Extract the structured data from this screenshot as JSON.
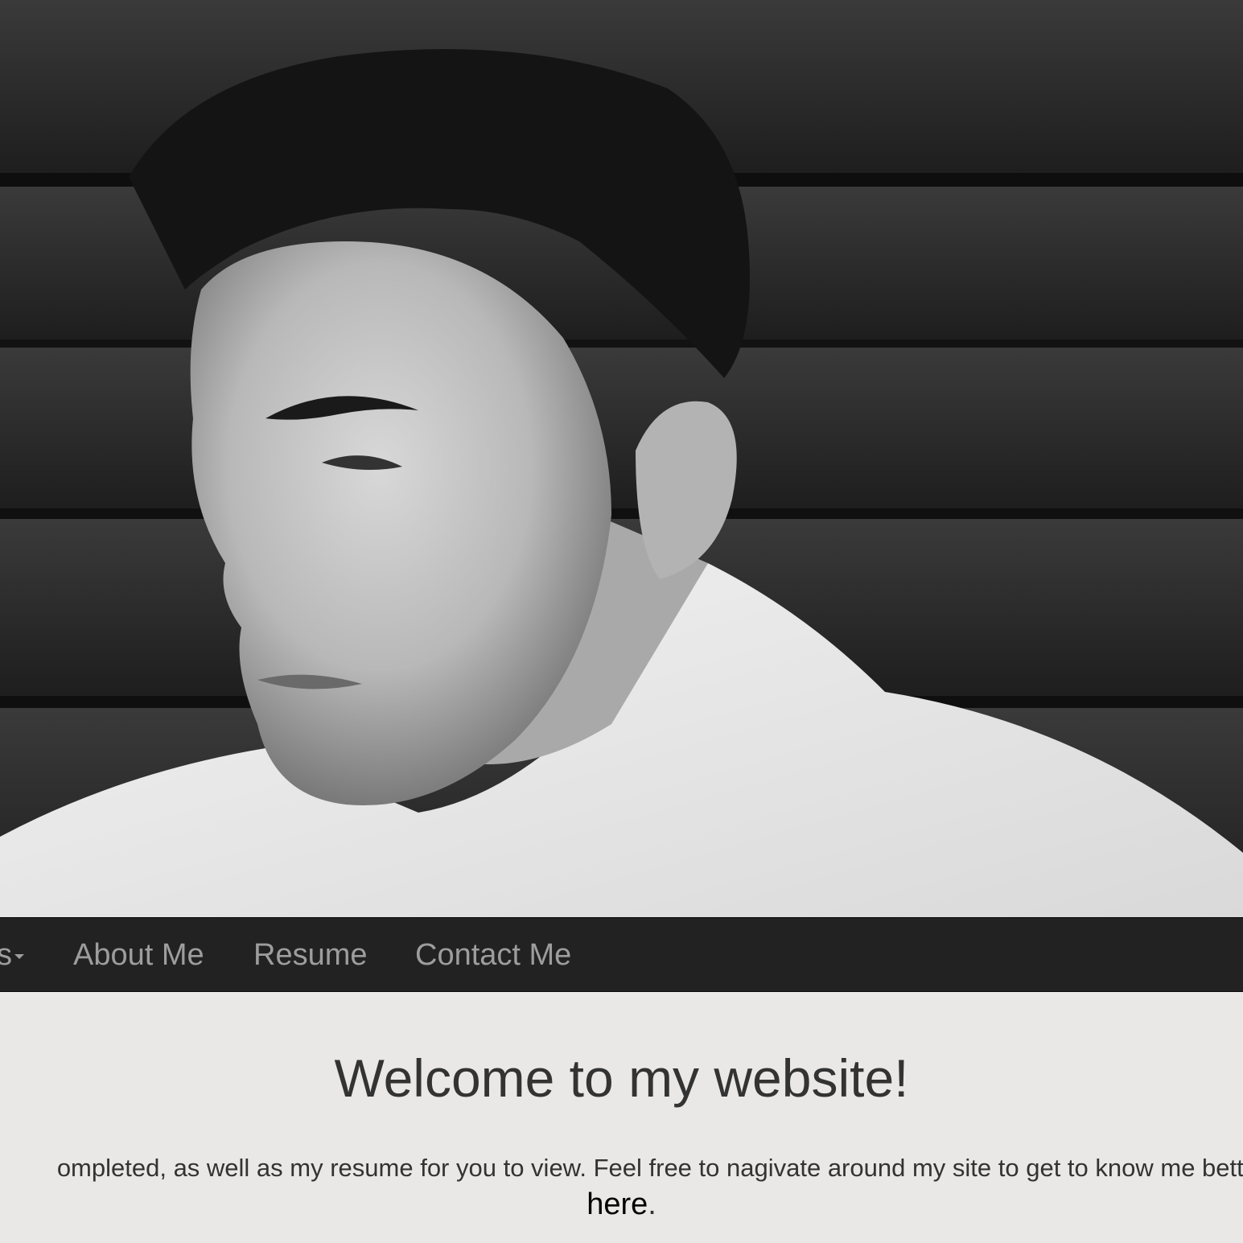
{
  "hero": {
    "image_alt": "Black and white portrait photo of a man in a white shirt in front of dark wooden planks"
  },
  "navbar": {
    "items": [
      {
        "label": "s"
      },
      {
        "label": "About Me"
      },
      {
        "label": "Resume"
      },
      {
        "label": "Contact Me"
      }
    ],
    "icons": {
      "projects_caret": "caret-down-icon"
    },
    "colors": {
      "background": "#222222",
      "text": "#9d9d9d"
    }
  },
  "main": {
    "heading": "Welcome to my website!",
    "intro": "ompleted, as well as my resume for you to view. Feel free to nagivate around my site to get to know me bette",
    "link_text": "here",
    "link_suffix": "."
  },
  "colors": {
    "page_background": "#e9e8e7",
    "heading_text": "#333333"
  }
}
